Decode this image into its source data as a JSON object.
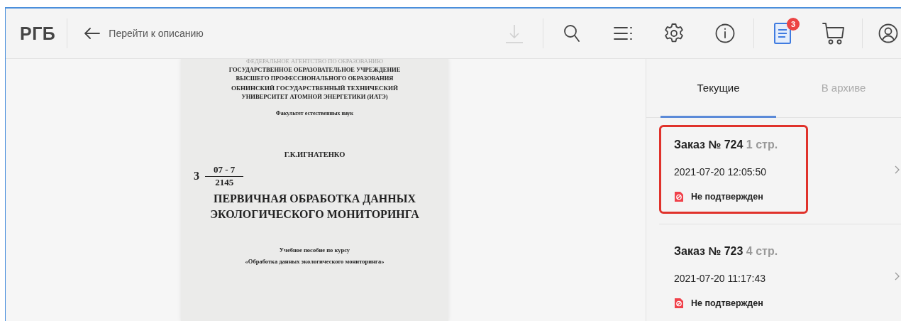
{
  "header": {
    "logo": "РГБ",
    "back_link": "Перейти к описанию",
    "toolbar": [
      [
        {
          "kind": "download",
          "disabled": true
        }
      ],
      [
        {
          "kind": "search",
          "disabled": false
        },
        {
          "kind": "contents",
          "disabled": false
        },
        {
          "kind": "settings",
          "disabled": false
        },
        {
          "kind": "info",
          "disabled": false
        }
      ],
      [
        {
          "kind": "orders",
          "disabled": false,
          "badge": "3"
        },
        {
          "kind": "cart",
          "disabled": false
        }
      ],
      [
        {
          "kind": "profile",
          "disabled": false
        }
      ]
    ]
  },
  "document": {
    "lines": [
      {
        "kind": "faded",
        "text": "ФЕДЕРАЛЬНОЕ АГЕНТСТВО ПО ОБРАЗОВАНИЮ"
      },
      {
        "kind": "org",
        "text": "ГОСУДАРСТВЕННОЕ ОБРАЗОВАТЕЛЬНОЕ УЧРЕЖДЕНИЕ"
      },
      {
        "kind": "org",
        "text": "ВЫСШЕГО ПРОФЕССИОНАЛЬНОГО ОБРАЗОВАНИЯ"
      },
      {
        "kind": "org2",
        "text": "ОБНИНСКИЙ ГОСУДАРСТВЕННЫЙ ТЕХНИЧЕСКИЙ"
      },
      {
        "kind": "org",
        "text": "УНИВЕРСИТЕТ АТОМНОЙ ЭНЕРГЕТИКИ (ИАТЭ)"
      },
      {
        "kind": "faculty",
        "text": "Факультет естественных наук"
      },
      {
        "kind": "author",
        "text": "Г.К.ИГНАТЕНКО"
      },
      {
        "kind": "code",
        "number": "3",
        "numerator": "07 - 7",
        "denominator": "2145"
      },
      {
        "kind": "title",
        "text": "ПЕРВИЧНАЯ ОБРАБОТКА ДАННЫХ"
      },
      {
        "kind": "title",
        "text": "ЭКОЛОГИЧЕСКОГО МОНИТОРИНГА"
      },
      {
        "kind": "subtitle",
        "text": "Учебное пособие по курсу"
      },
      {
        "kind": "course",
        "text": "«Обработка данных экологического мониторинга»"
      }
    ]
  },
  "orders_panel": {
    "tabs": [
      {
        "label": "Текущие",
        "selected": true
      },
      {
        "label": "В архиве",
        "selected": false
      }
    ],
    "orders": [
      {
        "title": "Заказ № 724",
        "pages": "1 стр.",
        "date": "2021-07-20 12:05:50",
        "status": "Не подтвержден",
        "highlighted": true
      },
      {
        "title": "Заказ № 723",
        "pages": "4 стр.",
        "date": "2021-07-20 11:17:43",
        "status": "Не подтвержден",
        "highlighted": false
      }
    ]
  }
}
